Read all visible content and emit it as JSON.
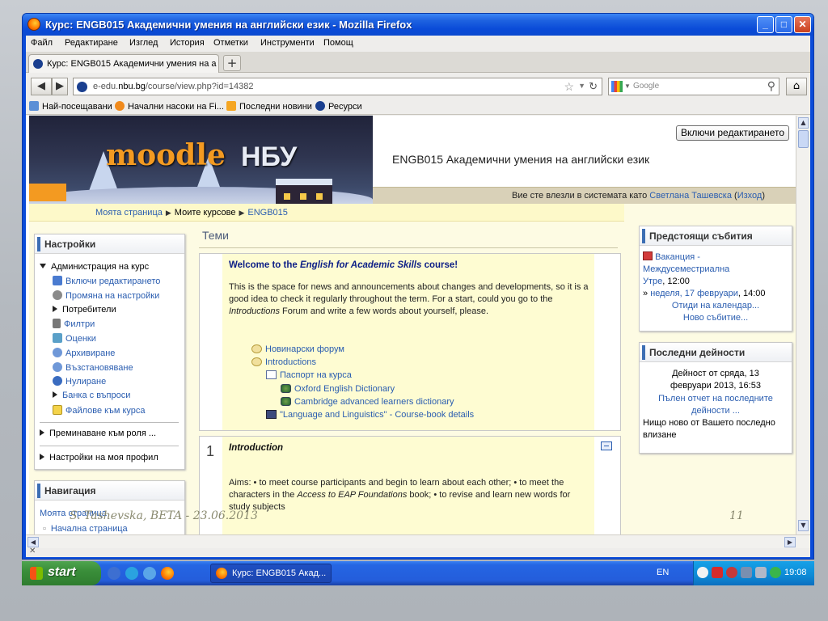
{
  "window": {
    "title": "Курс: ENGB015 Академични умения на английски език - Mozilla Firefox"
  },
  "menubar": [
    "Файл",
    "Редактиране",
    "Изглед",
    "История",
    "Отметки",
    "Инструменти",
    "Помощ"
  ],
  "tab": {
    "label": "Курс: ENGB015 Академични умения на анг...",
    "new_tab": "+"
  },
  "urlbar": {
    "url_prefix": "e-edu.",
    "url_domain": "nbu.bg",
    "url_path": "/course/view.php?id=14382"
  },
  "search": {
    "placeholder": "Google"
  },
  "bookmarks": [
    "Най-посещавани",
    "Начални насоки на Fi...",
    "Последни новини",
    "Ресурси"
  ],
  "header": {
    "edit_button": "Включи редактирането",
    "course_title": "ENGB015 Академични умения на английски език",
    "login_text": "Вие сте влезли в системата като",
    "user_name": "Светлана Ташевска",
    "logout": "Изход",
    "logo_left": "moodle",
    "logo_right": "НБУ"
  },
  "breadcrumb": [
    "Моята страница",
    "Моите курсове",
    "ENGB015"
  ],
  "settings_block": {
    "title": "Настройки",
    "admin": "Администрация на курс",
    "items": [
      "Включи редактирането",
      "Промяна на настройки",
      "Потребители",
      "Филтри",
      "Оценки",
      "Архивиране",
      "Възстановяване",
      "Нулиране",
      "Банка с въпроси",
      "Файлове към курса"
    ],
    "switch_role": "Преминаване към роля ...",
    "profile": "Настройки на моя профил"
  },
  "navigation_block": {
    "title": "Навигация",
    "items": [
      "Моята страница",
      "Начална страница"
    ]
  },
  "topics": {
    "heading": "Теми",
    "welcome_prefix": "Welcome to the ",
    "welcome_italic": "English for Academic Skills",
    "welcome_suffix": " course!",
    "intro_p1": "This is the space for news and announcements about changes and developments, so it is a good idea to check it regularly throughout the term. For a start, could you go to the ",
    "intro_italic": "Introductions",
    "intro_p2": " Forum and write a few words  about yourself, please.",
    "resources": [
      "Новинарски форум",
      "Introductions",
      "Паспорт на курса",
      "Oxford English Dictionary",
      "Cambridge advanced learners dictionary",
      "\"Language and Linguistics\" - Course-book details"
    ],
    "section1_num": "1",
    "section1_title": "Introduction",
    "aims_p1": "Aims: • to meet course participants and begin to learn about each other; • to meet the characters in the ",
    "aims_italic": "Access to EAP Foundations",
    "aims_p2": " book; • to revise and learn new words for study subjects"
  },
  "events_block": {
    "title": "Предстоящи събития",
    "event_name": "Ваканция - Междусеместриална",
    "event_day": "Утре",
    "event_time": ", 12:00",
    "event_end_prefix": "» ",
    "event_end_day": "неделя, 17 февруари",
    "event_end_time": ", 14:00",
    "goto_calendar": "Отиди на календар...",
    "new_event": "Ново събитие..."
  },
  "activity_block": {
    "title": "Последни дейности",
    "since": "Дейност от сряда, 13 февруари 2013, 16:53",
    "full_report": "Пълен отчет на последните дейности ...",
    "nothing_new": "Нищо ново от Вашето последно влизане"
  },
  "slide": {
    "footer": "S. Tashevska, BETA - 23.06.2013",
    "page_number": "11"
  },
  "taskbar": {
    "start": "start",
    "task_label": "Курс: ENGB015 Акад...",
    "language": "EN",
    "clock": "19:08"
  }
}
